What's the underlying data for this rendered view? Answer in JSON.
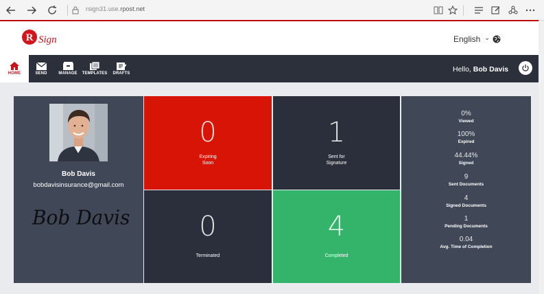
{
  "browser": {
    "url_host": "rsign31.use.",
    "url_domain": "rpost.net"
  },
  "header": {
    "language": "English",
    "language_caret": "⌄"
  },
  "nav": {
    "items": [
      {
        "label": "HOME",
        "icon": "home-icon"
      },
      {
        "label": "SEND",
        "icon": "envelope-icon"
      },
      {
        "label": "MANAGE",
        "icon": "inbox-icon"
      },
      {
        "label": "TEMPLATES",
        "icon": "templates-icon"
      },
      {
        "label": "DRAFTS",
        "icon": "drafts-icon"
      }
    ],
    "greeting": "Hello,",
    "user_name": "Bob Davis"
  },
  "profile": {
    "name": "Bob Davis",
    "email": "bobdavisinsurance@gmail.com",
    "signature_text": "Bob Davis"
  },
  "tiles": [
    {
      "value": "0",
      "label_line1": "Expiring",
      "label_line2": "Soon",
      "color": "#d81406"
    },
    {
      "value": "1",
      "label_line1": "Sent for",
      "label_line2": "Signature",
      "color": "#2a2f3b"
    },
    {
      "value": "0",
      "label_line1": "Terminated",
      "label_line2": "",
      "color": "#2a2f3b"
    },
    {
      "value": "4",
      "label_line1": "Completed",
      "label_line2": "",
      "color": "#34b36b"
    }
  ],
  "stats": [
    {
      "value": "0%",
      "label": "Viewed"
    },
    {
      "value": "100%",
      "label": "Expired"
    },
    {
      "value": "44.44%",
      "label": "Signed"
    },
    {
      "value": "9",
      "label": "Sent Documents"
    },
    {
      "value": "4",
      "label": "Signed Documents"
    },
    {
      "value": "1",
      "label": "Pending Documents"
    },
    {
      "value": "0.04",
      "label": "Avg. Time of Completion"
    }
  ],
  "colors": {
    "accent_red": "#c4151c",
    "navbar": "#2b303b",
    "panel": "#404757",
    "success": "#34b36b"
  }
}
